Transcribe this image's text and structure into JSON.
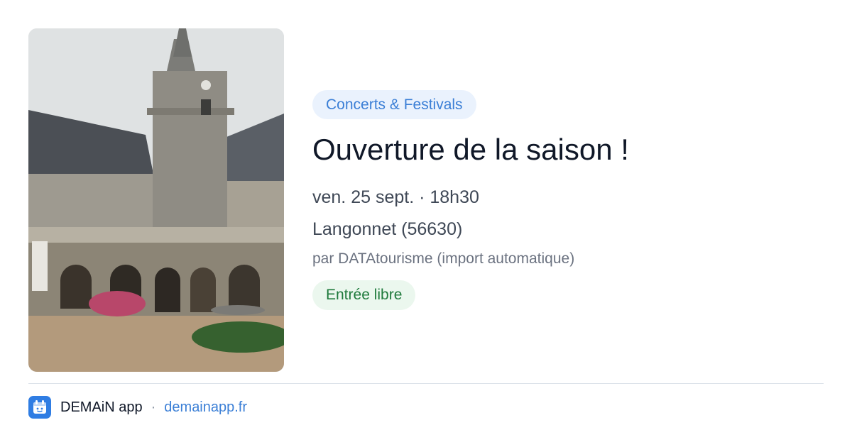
{
  "event": {
    "category": "Concerts & Festivals",
    "title": "Ouverture de la saison !",
    "datetime": "ven. 25 sept. · 18h30",
    "location": "Langonnet (56630)",
    "source": "par DATAtourisme (import automatique)",
    "price": "Entrée libre",
    "image_alt": "cloister-courtyard-photo"
  },
  "footer": {
    "app_name": "DEMAiN app",
    "separator": "·",
    "link_text": "demainapp.fr"
  },
  "colors": {
    "accent": "#3b7fd6",
    "category_bg": "#eaf2fd",
    "price_bg": "#ebf7ee",
    "price_text": "#1f7a3c",
    "title_text": "#101828"
  }
}
